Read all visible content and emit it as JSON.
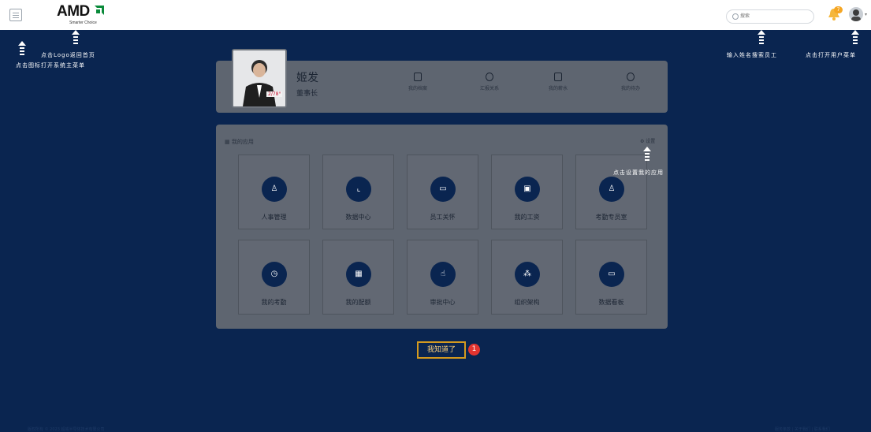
{
  "header": {
    "logo_text": "AMD",
    "logo_sub": "Smarter Choice",
    "search_placeholder": "搜索",
    "notification_count": "7"
  },
  "profile": {
    "name": "姬发",
    "title": "董事长",
    "photo_tag": "2/78°",
    "quick_links": [
      "我的档案",
      "汇报关系",
      "我的薪水",
      "我的待办"
    ]
  },
  "apps": {
    "heading": "我的应用",
    "settings_label": "设置",
    "tiles": [
      {
        "label": "人事管理",
        "icon": "user-icon"
      },
      {
        "label": "数据中心",
        "icon": "chart-icon"
      },
      {
        "label": "员工关怀",
        "icon": "new-icon"
      },
      {
        "label": "我的工资",
        "icon": "salary-icon"
      },
      {
        "label": "考勤专员室",
        "icon": "user-settings-icon"
      },
      {
        "label": "我的考勤",
        "icon": "clock-icon"
      },
      {
        "label": "我的配额",
        "icon": "calendar-icon"
      },
      {
        "label": "审批中心",
        "icon": "hand-icon"
      },
      {
        "label": "组织架构",
        "icon": "org-icon"
      },
      {
        "label": "数据看板",
        "icon": "monitor-icon"
      }
    ]
  },
  "hints": {
    "menu": "点击图标打开系统主菜单",
    "logo": "点击Logo返回首页",
    "search": "输入姓名搜索员工",
    "user": "点击打开用户菜单",
    "app_settings": "点击设置我的应用"
  },
  "guide": {
    "ok_label": "我知道了",
    "step": "1"
  },
  "footer": {
    "left": "版权所有 © 2023 超威半导体技术有限公司",
    "right": "服务条款 | 关于我们 | 联系我们"
  }
}
